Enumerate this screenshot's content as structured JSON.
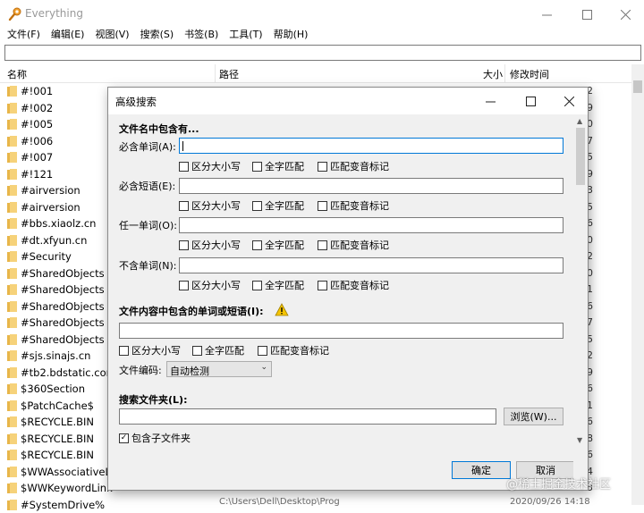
{
  "window": {
    "title": "Everything"
  },
  "menu": [
    "文件(F)",
    "编辑(E)",
    "视图(V)",
    "搜索(S)",
    "书签(B)",
    "工具(T)",
    "帮助(H)"
  ],
  "columns": {
    "name": "名称",
    "path": "路径",
    "size": "大小",
    "modified": "修改时间"
  },
  "rows": [
    {
      "name": "#!001",
      "right": "2"
    },
    {
      "name": "#!002",
      "right": "9"
    },
    {
      "name": "#!005",
      "right": "0"
    },
    {
      "name": "#!006",
      "right": "7"
    },
    {
      "name": "#!007",
      "right": "5"
    },
    {
      "name": "#!121",
      "right": "9"
    },
    {
      "name": "#airversion",
      "right": "3"
    },
    {
      "name": "#airversion",
      "right": "5"
    },
    {
      "name": "#bbs.xiaolz.cn",
      "right": "6"
    },
    {
      "name": "#dt.xfyun.cn",
      "right": "0"
    },
    {
      "name": "#Security",
      "right": "2"
    },
    {
      "name": "#SharedObjects",
      "right": "0"
    },
    {
      "name": "#SharedObjects",
      "right": "1"
    },
    {
      "name": "#SharedObjects",
      "right": "6"
    },
    {
      "name": "#SharedObjects",
      "right": "7"
    },
    {
      "name": "#SharedObjects",
      "right": "5"
    },
    {
      "name": "#sjs.sinajs.cn",
      "right": "2"
    },
    {
      "name": "#tb2.bdstatic.com",
      "right": "9"
    },
    {
      "name": "$360Section",
      "right": "6"
    },
    {
      "name": "$PatchCache$",
      "right": "1"
    },
    {
      "name": "$RECYCLE.BIN",
      "right": "6"
    },
    {
      "name": "$RECYCLE.BIN",
      "right": "8"
    },
    {
      "name": "$RECYCLE.BIN",
      "right": "6"
    },
    {
      "name": "$WWAssociativeLi",
      "right": "4"
    },
    {
      "name": "$WWKeywordLink",
      "right": "3"
    },
    {
      "name": "#SystemDrive%",
      "right": ""
    }
  ],
  "partial_bottom": {
    "path": "C:\\Users\\Dell\\Desktop\\Prog",
    "time": "2020/09/26 14:18"
  },
  "dialog": {
    "title": "高级搜索",
    "filename_section": "文件名中包含有...",
    "must_words_label": "必含单词(A):",
    "must_phrase_label": "必含短语(E):",
    "any_word_label": "任一单词(O):",
    "exclude_label": "不含单词(N):",
    "opt_case": "区分大小写",
    "opt_whole": "全字匹配",
    "opt_diacritics": "匹配变音标记",
    "content_section": "文件内容中包含的单词或短语(I):",
    "encoding_label": "文件编码:",
    "encoding_value": "自动检测",
    "folder_section": "搜索文件夹(L):",
    "browse": "浏览(W)...",
    "include_sub": "包含子文件夹",
    "ok": "确定",
    "cancel": "取消"
  },
  "watermark": "@稀土掘金技术社区"
}
